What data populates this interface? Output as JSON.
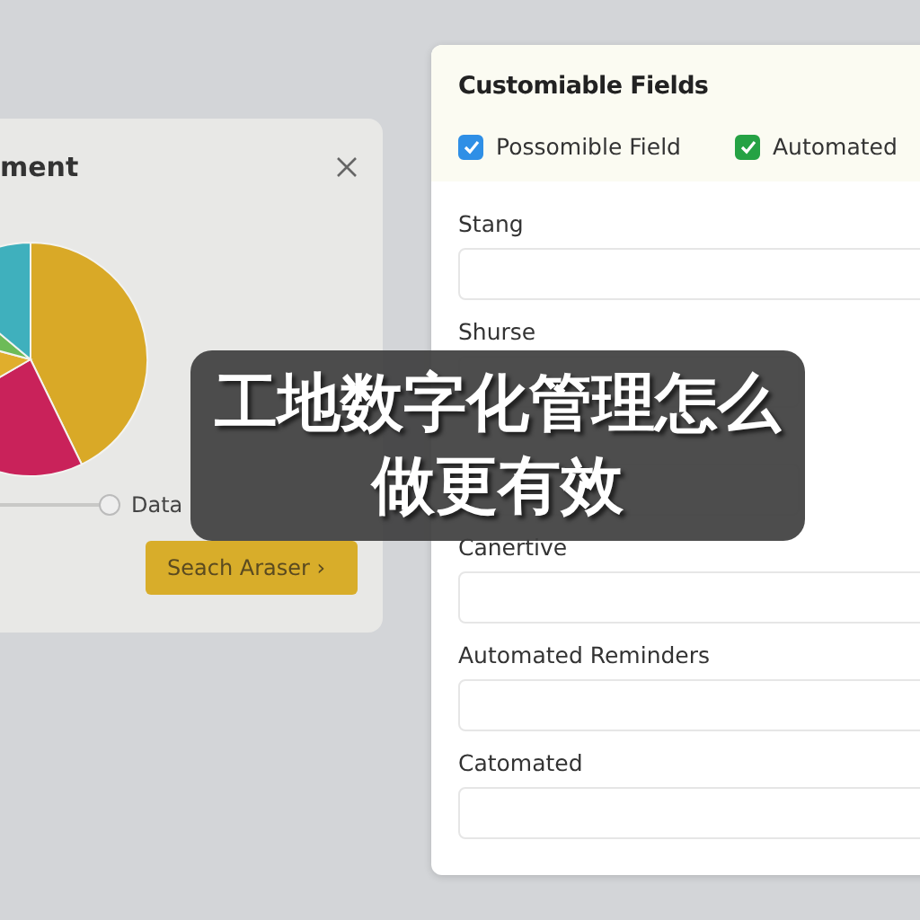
{
  "left_panel": {
    "title": "ment",
    "slider": {
      "level": 1
    },
    "slider_label": "Data",
    "button": "Seach Araser ›"
  },
  "right_panel": {
    "title": "Customiable Fields",
    "checkboxes": [
      {
        "label": "Possomible Field",
        "checked": true,
        "color": "#2f8fe6"
      },
      {
        "label": "Automated",
        "checked": true,
        "color": "#25a244"
      }
    ],
    "fields": [
      {
        "kind": "labeled",
        "label": "Stang"
      },
      {
        "kind": "covered",
        "label": "Shurse"
      },
      {
        "kind": "labeled",
        "label": "Canertive"
      },
      {
        "kind": "labeled",
        "label": "Automated Reminders"
      },
      {
        "kind": "labeled",
        "label": "Catomated"
      }
    ]
  },
  "caption": [
    "工地数字化管理怎么",
    "做更有效"
  ]
}
